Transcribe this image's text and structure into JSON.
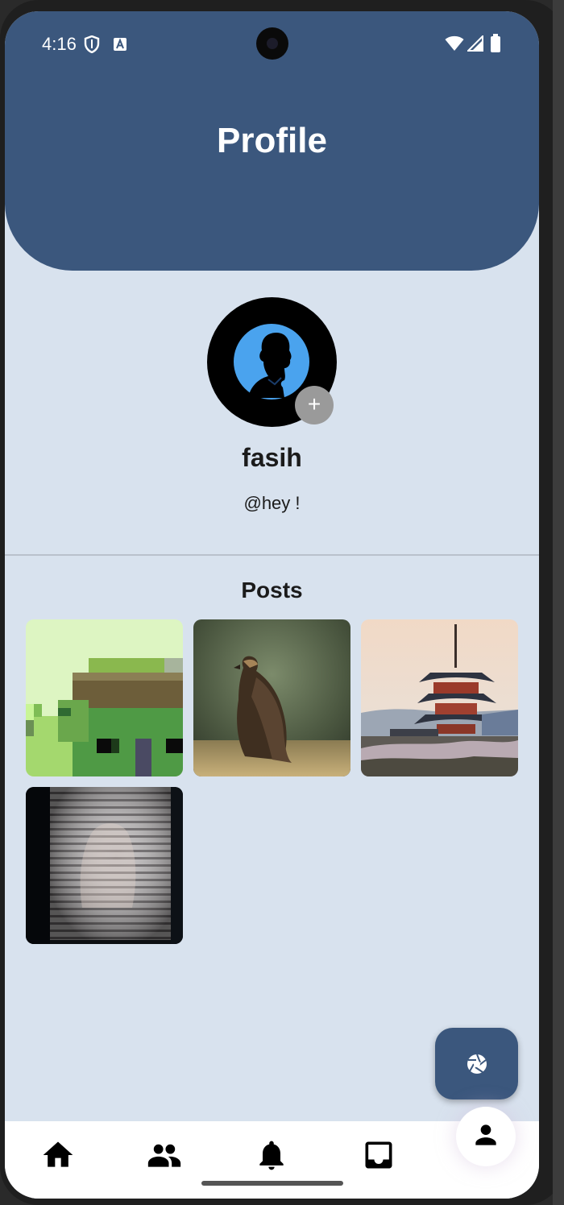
{
  "status_bar": {
    "time": "4:16"
  },
  "header": {
    "title": "Profile"
  },
  "profile": {
    "name": "fasih",
    "handle": "@hey !",
    "add_symbol": "+"
  },
  "posts": {
    "title": "Posts",
    "items": [
      {
        "kind": "pixel-art-house"
      },
      {
        "kind": "eagle-photo"
      },
      {
        "kind": "pagoda-photo"
      },
      {
        "kind": "window-blinds-photo"
      }
    ]
  },
  "fab": {
    "icon": "camera-aperture-icon"
  },
  "bottom_nav": {
    "items": [
      "home-icon",
      "people-icon",
      "bell-icon",
      "inbox-icon",
      "person-icon"
    ],
    "active": "person-icon"
  },
  "colors": {
    "header": "#3b577d",
    "background": "#d8e2ee",
    "nav": "#ffffff"
  }
}
